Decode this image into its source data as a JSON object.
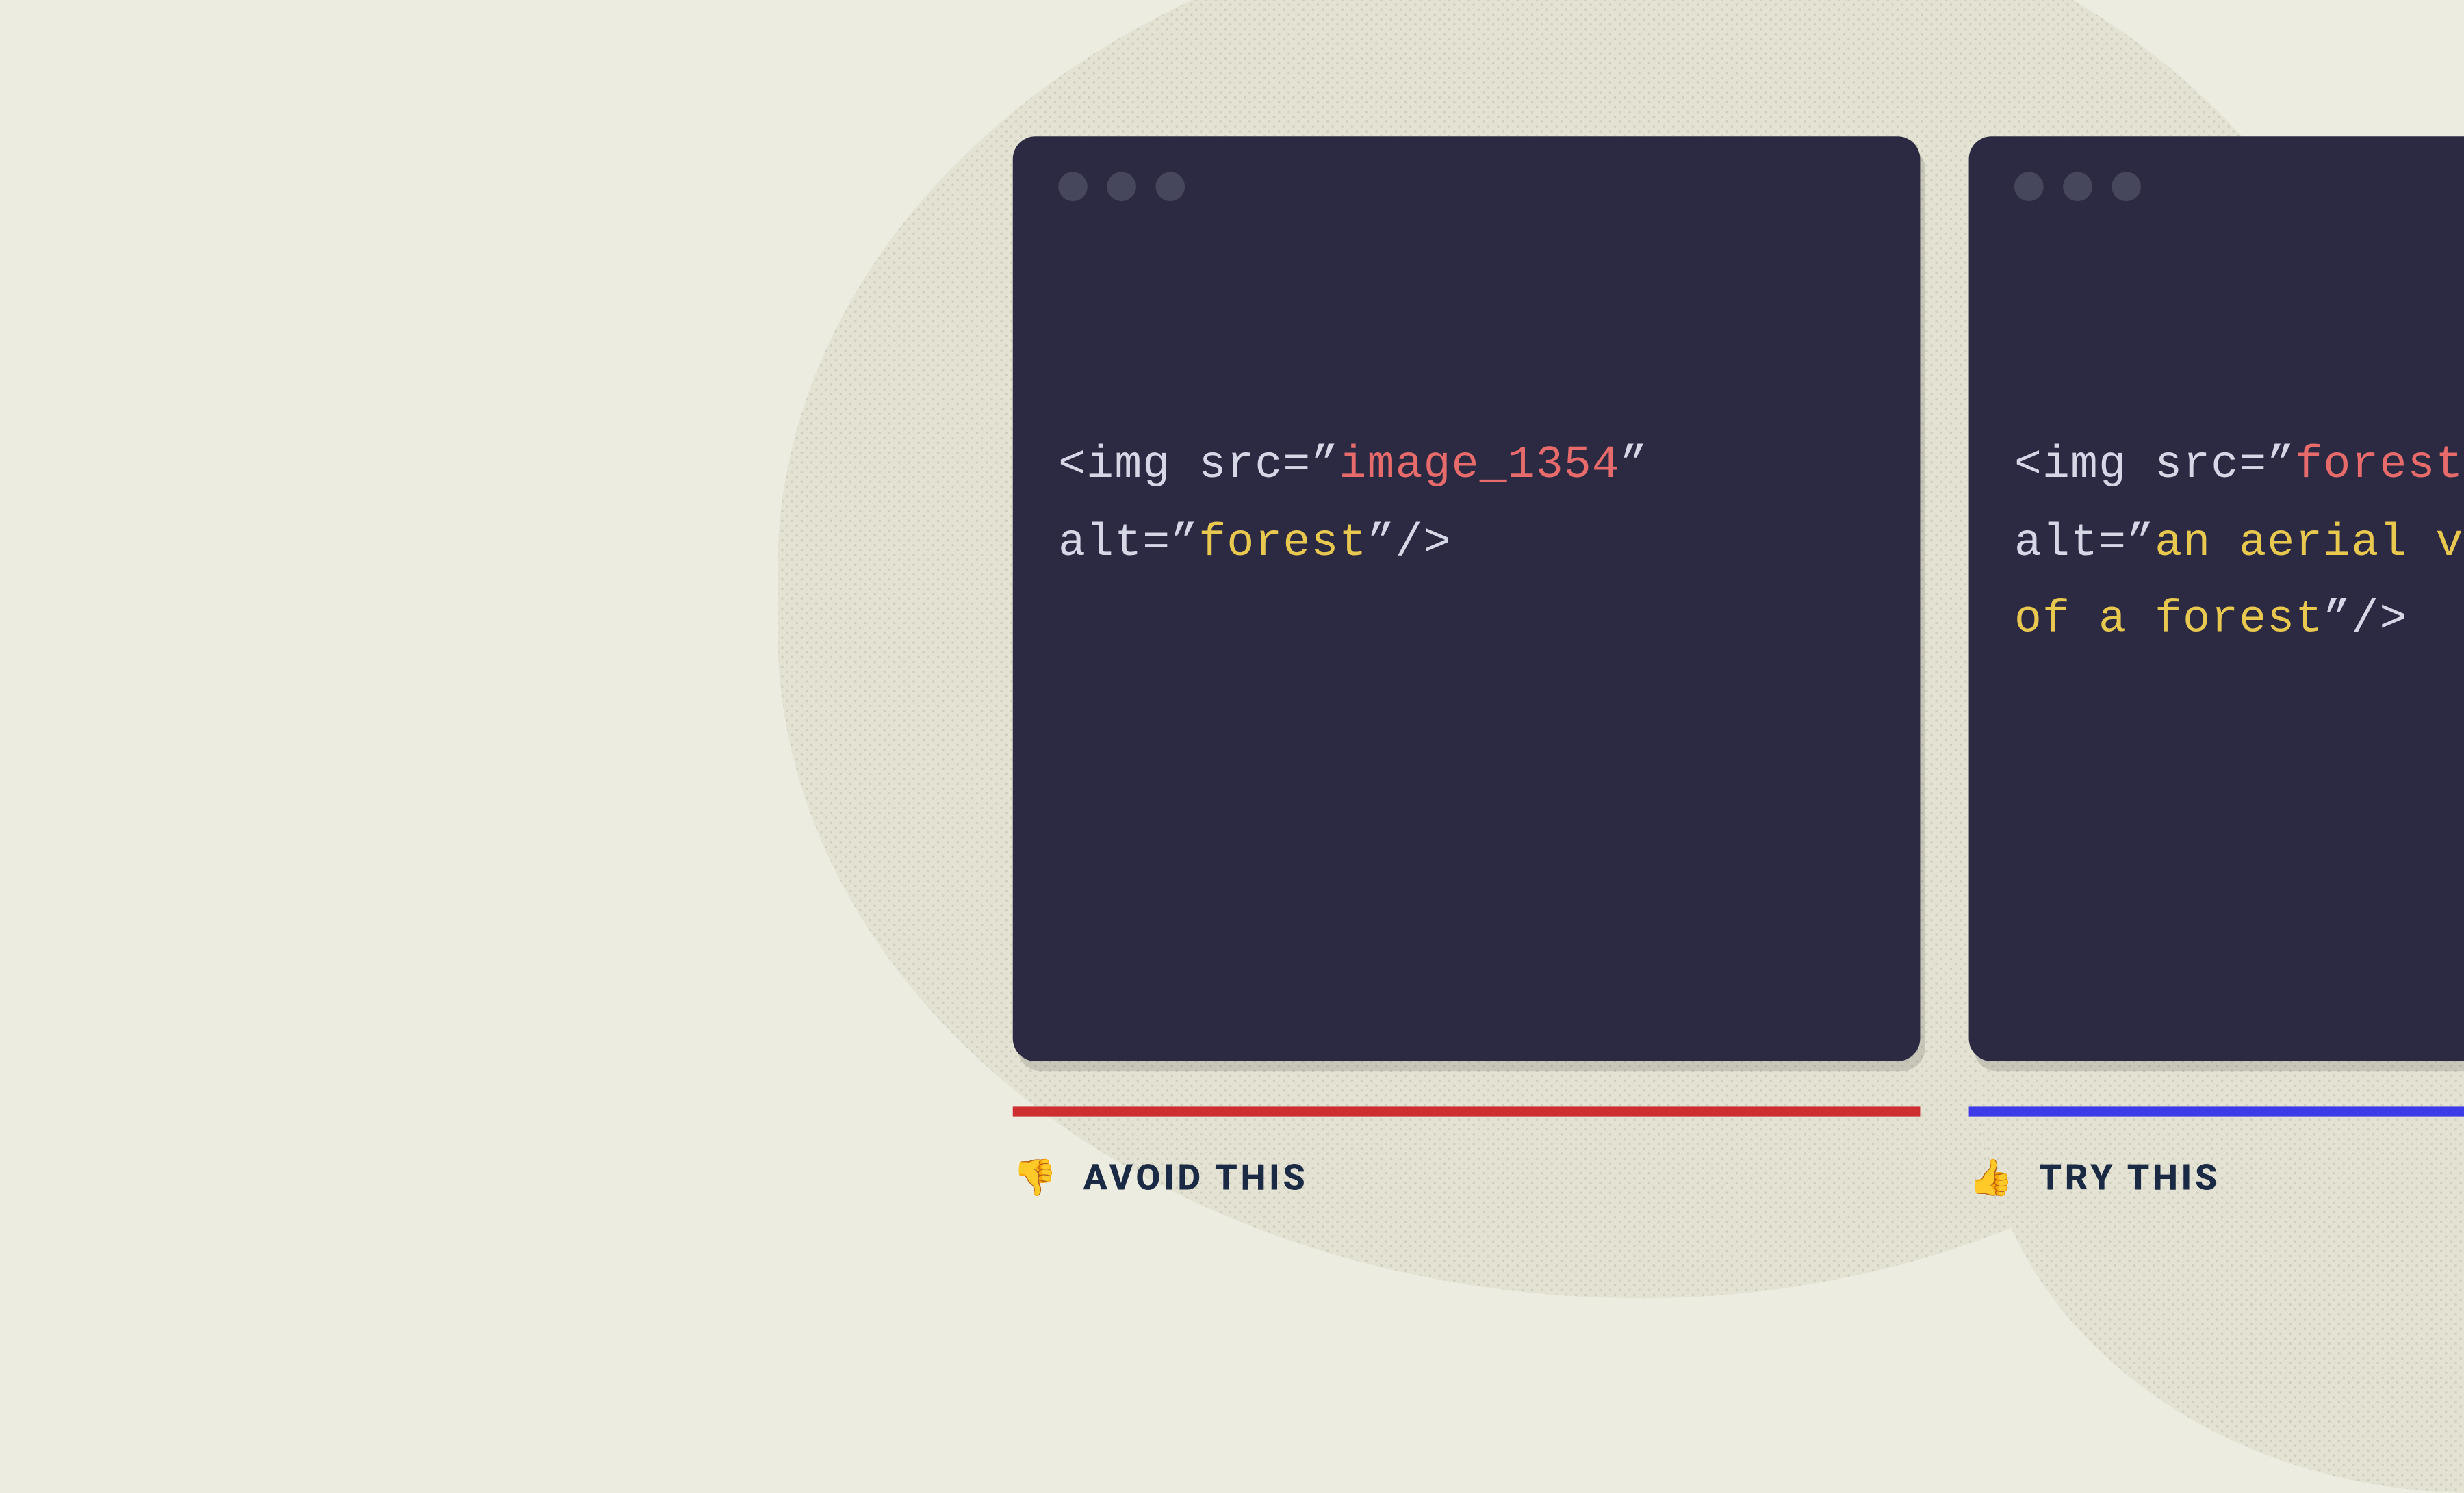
{
  "colors": {
    "background": "#edece1",
    "card_bg": "#2b2a42",
    "code_default": "#d6d7e6",
    "code_red": "#e76b6b",
    "code_yellow": "#e8c84f",
    "underline_red": "#cd2f31",
    "underline_blue": "#3d3be8",
    "caption_text": "#1b2a44",
    "spark": "#4a47e6"
  },
  "left": {
    "caption_emoji": "👎",
    "caption_text": "AVOID THIS",
    "code": {
      "tag_open": "<img",
      "src_key": " src=",
      "src_q1": "”",
      "src_val": "image_1354",
      "src_q2": "”",
      "alt_key": "alt=",
      "alt_q1": "”",
      "alt_val": "forest",
      "alt_q2": "”",
      "tag_close": "/>"
    }
  },
  "right": {
    "caption_emoji": "👍",
    "caption_text": "TRY THIS",
    "code": {
      "tag_open": "<img",
      "src_key": " src=",
      "src_q1": "”",
      "src_val": "forest",
      "src_q2": "”",
      "alt_key": "alt=",
      "alt_q1": "”",
      "alt_val_l1": "an aerial view",
      "alt_val_l2": "of a forest",
      "alt_q2": "”",
      "tag_close": "/>"
    }
  }
}
